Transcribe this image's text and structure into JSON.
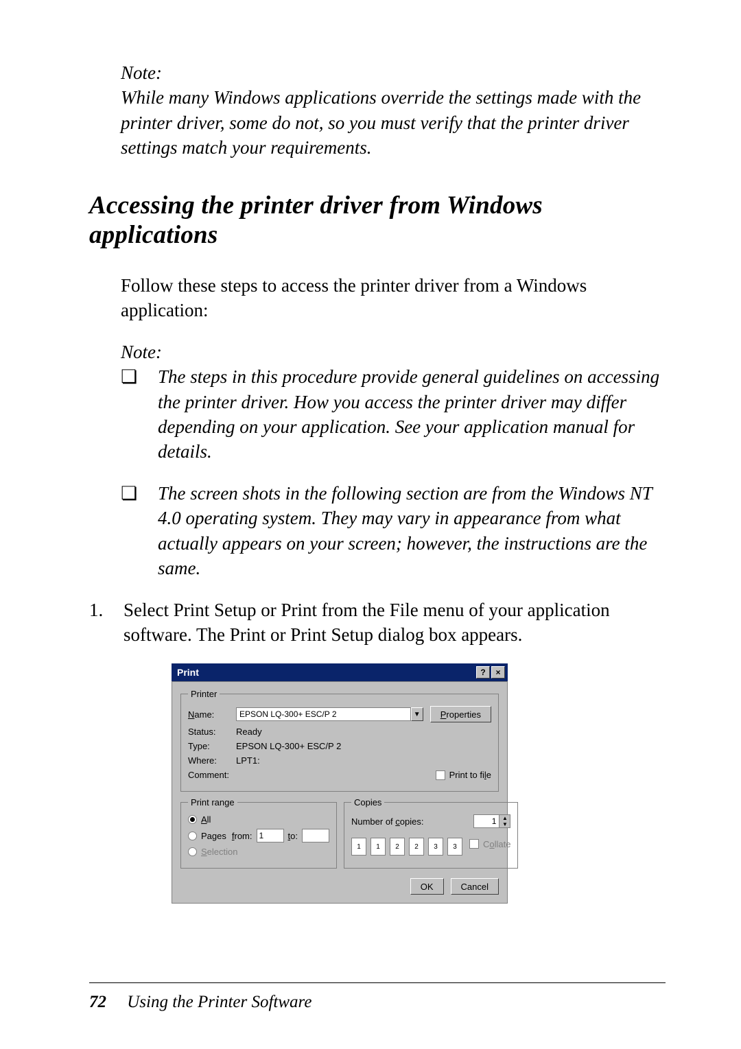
{
  "note1": {
    "head": "Note:",
    "body": "While many Windows applications override the settings made with the printer driver, some do not, so you must verify that the printer driver settings match your requirements."
  },
  "section_title": "Accessing the printer driver from Windows applications",
  "intro": "Follow these steps to access the printer driver from a Windows application:",
  "note2": {
    "head": "Note:",
    "bullets": [
      "The steps in this procedure provide general guidelines on accessing the printer driver. How you access the printer driver may differ depending on your application. See your application manual for details.",
      "The screen shots in the following section are from the Windows NT 4.0 operating system. They may vary in appearance from what actually appears on your screen; however, the instructions are the same."
    ],
    "bullet_mark": "❏"
  },
  "steps": [
    {
      "num": "1.",
      "text": "Select Print Setup or Print from the File menu of your application software. The Print or Print Setup dialog box appears."
    }
  ],
  "dialog": {
    "title": "Print",
    "help_glyph": "?",
    "close_glyph": "×",
    "printer": {
      "legend": "Printer",
      "name_label": "Name:",
      "name_value": "EPSON LQ-300+ ESC/P 2",
      "properties_btn": "Properties",
      "status_label": "Status:",
      "status_value": "Ready",
      "type_label": "Type:",
      "type_value": "EPSON LQ-300+ ESC/P 2",
      "where_label": "Where:",
      "where_value": "LPT1:",
      "comment_label": "Comment:",
      "comment_value": "",
      "print_to_file_label": "Print to file"
    },
    "range": {
      "legend": "Print range",
      "all_label": "All",
      "pages_label": "Pages",
      "from_label": "from:",
      "from_value": "1",
      "to_label": "to:",
      "to_value": "",
      "selection_label": "Selection"
    },
    "copies": {
      "legend": "Copies",
      "num_label": "Number of copies:",
      "num_value": "1",
      "collate_label": "Collate",
      "page_icons": [
        "1",
        "1",
        "2",
        "2",
        "3",
        "3"
      ]
    },
    "ok_btn": "OK",
    "cancel_btn": "Cancel"
  },
  "footer": {
    "page_number": "72",
    "chapter_title": "Using the Printer Software"
  }
}
